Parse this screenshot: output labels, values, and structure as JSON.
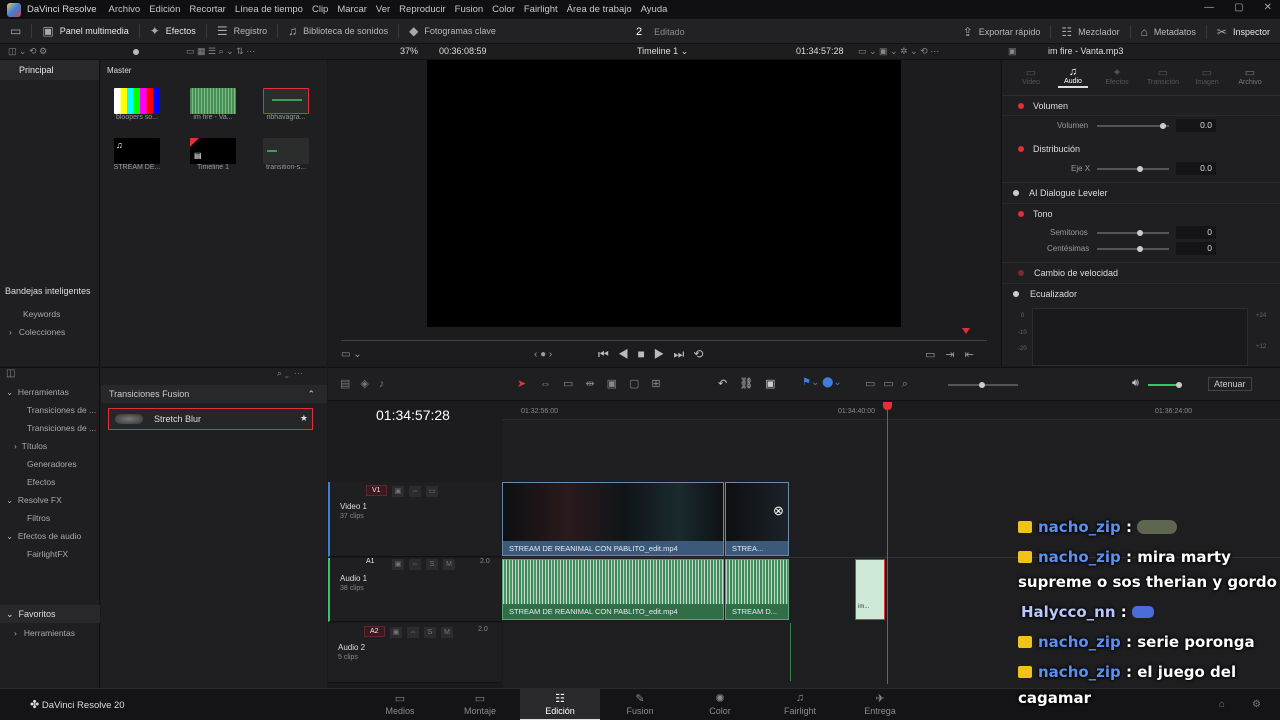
{
  "menubar": {
    "app_name": "DaVinci Resolve",
    "items": [
      "Archivo",
      "Edición",
      "Recortar",
      "Línea de tiempo",
      "Clip",
      "Marcar",
      "Ver",
      "Reproducir",
      "Fusion",
      "Color",
      "Fairlight",
      "Área de trabajo",
      "Ayuda"
    ]
  },
  "toolbar": {
    "media_pool": "Panel multimedia",
    "effects": "Efectos",
    "log": "Registro",
    "sound_library": "Biblioteca de sonidos",
    "keyframes": "Fotogramas clave",
    "project_number": "2",
    "project_status": "Editado",
    "quick_export": "Exportar rápido",
    "mixer": "Mezclador",
    "metadata": "Metadatos",
    "inspector": "Inspector"
  },
  "viewer": {
    "zoom": "37%",
    "source_timecode": "00:36:08:59",
    "timeline_name": "Timeline 1",
    "record_timecode": "01:34:57:28",
    "inspected_clip": "im fire - Vanta.mp3"
  },
  "media_pool": {
    "bin_root": "Principal",
    "bin_current": "Master",
    "clips": [
      {
        "label": "bloopers so..."
      },
      {
        "label": "im fire - Va..."
      },
      {
        "label": "ribhavagra..."
      },
      {
        "label": "STREAM DE..."
      },
      {
        "label": "Timeline 1"
      },
      {
        "label": "transition-s..."
      }
    ],
    "smart_bins_header": "Bandejas inteligentes",
    "smart_bins": [
      "Keywords",
      "Colecciones"
    ]
  },
  "effects": {
    "tree": [
      "Herramientas",
      "Transiciones de ...",
      "Transiciones de ...",
      "Títulos",
      "Generadores",
      "Efectos",
      "Resolve FX",
      "Filtros",
      "Efectos de audio",
      "FairlightFX"
    ],
    "favorites_header": "Favoritos",
    "favorites": [
      "Herramientas"
    ],
    "category": "Transiciones Fusion",
    "selected_effect": "Stretch Blur"
  },
  "inspector": {
    "tabs": [
      "Video",
      "Audio",
      "Efectos",
      "Transición",
      "Imagen",
      "Archivo"
    ],
    "active_tab": "Audio",
    "volume_header": "Volumen",
    "volume_label": "Volumen",
    "volume_value": "0.0",
    "pan_header": "Distribución",
    "pan_label": "Eje X",
    "pan_value": "0.0",
    "dialogue_leveler": "AI Dialogue Leveler",
    "pitch_header": "Tono",
    "semitones_label": "Semitonos",
    "semitones_value": "0",
    "cents_label": "Centésimas",
    "cents_value": "0",
    "speed_change": "Cambio de velocidad",
    "equalizer": "Ecualizador",
    "eq_scale_left": [
      "0",
      "-10",
      "-20"
    ],
    "eq_scale_right": [
      "+24",
      "+12"
    ]
  },
  "timeline": {
    "timecode": "01:34:57:28",
    "ruler": [
      "01:32:56:00",
      "01:34:40:00",
      "01:36:24:00"
    ],
    "audio_mode": "Atenuar",
    "tracks": {
      "v1": {
        "tag": "V1",
        "name": "Video 1",
        "count": "37 clips"
      },
      "a1": {
        "tag": "A1",
        "name": "Audio 1",
        "count": "38 clips",
        "level": "2.0"
      },
      "a2": {
        "tag": "A2",
        "name": "Audio 2",
        "count": "5 clips",
        "level": "2.0"
      }
    },
    "clips": {
      "video_main": "STREAM DE REANIMAL CON PABLITO_edit.mp4",
      "video_second": "STREA...",
      "audio_main": "STREAM DE REANIMAL CON PABLITO_edit.mp4",
      "audio_second": "STREAM D...",
      "audio_small": "im..."
    }
  },
  "chat": [
    {
      "user": "nacho_zip",
      "message": "",
      "has_emote": true,
      "badge": true
    },
    {
      "user": "nacho_zip",
      "message": "mira marty",
      "badge": true
    },
    {
      "user": "",
      "message": "supreme o sos therian y gordo",
      "badge": false
    },
    {
      "user": "Halycco_nn",
      "message": "",
      "has_emote": true,
      "badge": false
    },
    {
      "user": "nacho_zip",
      "message": "serie poronga",
      "badge": true
    },
    {
      "user": "nacho_zip",
      "message": "el juego del",
      "badge": true
    },
    {
      "user": "",
      "message": "cagamar",
      "badge": false
    }
  ],
  "pagenav": {
    "brand": "DaVinci Resolve 20",
    "pages": [
      "Medios",
      "Montaje",
      "Edición",
      "Fusion",
      "Color",
      "Fairlight",
      "Entrega"
    ],
    "active": "Edición"
  },
  "colors": {
    "accent_red": "#e0303a",
    "clip_video": "#3b5a7a",
    "clip_audio": "#2f6e47",
    "chat_user": "#5b8ff0",
    "chat_badge": "#f1c31a"
  }
}
